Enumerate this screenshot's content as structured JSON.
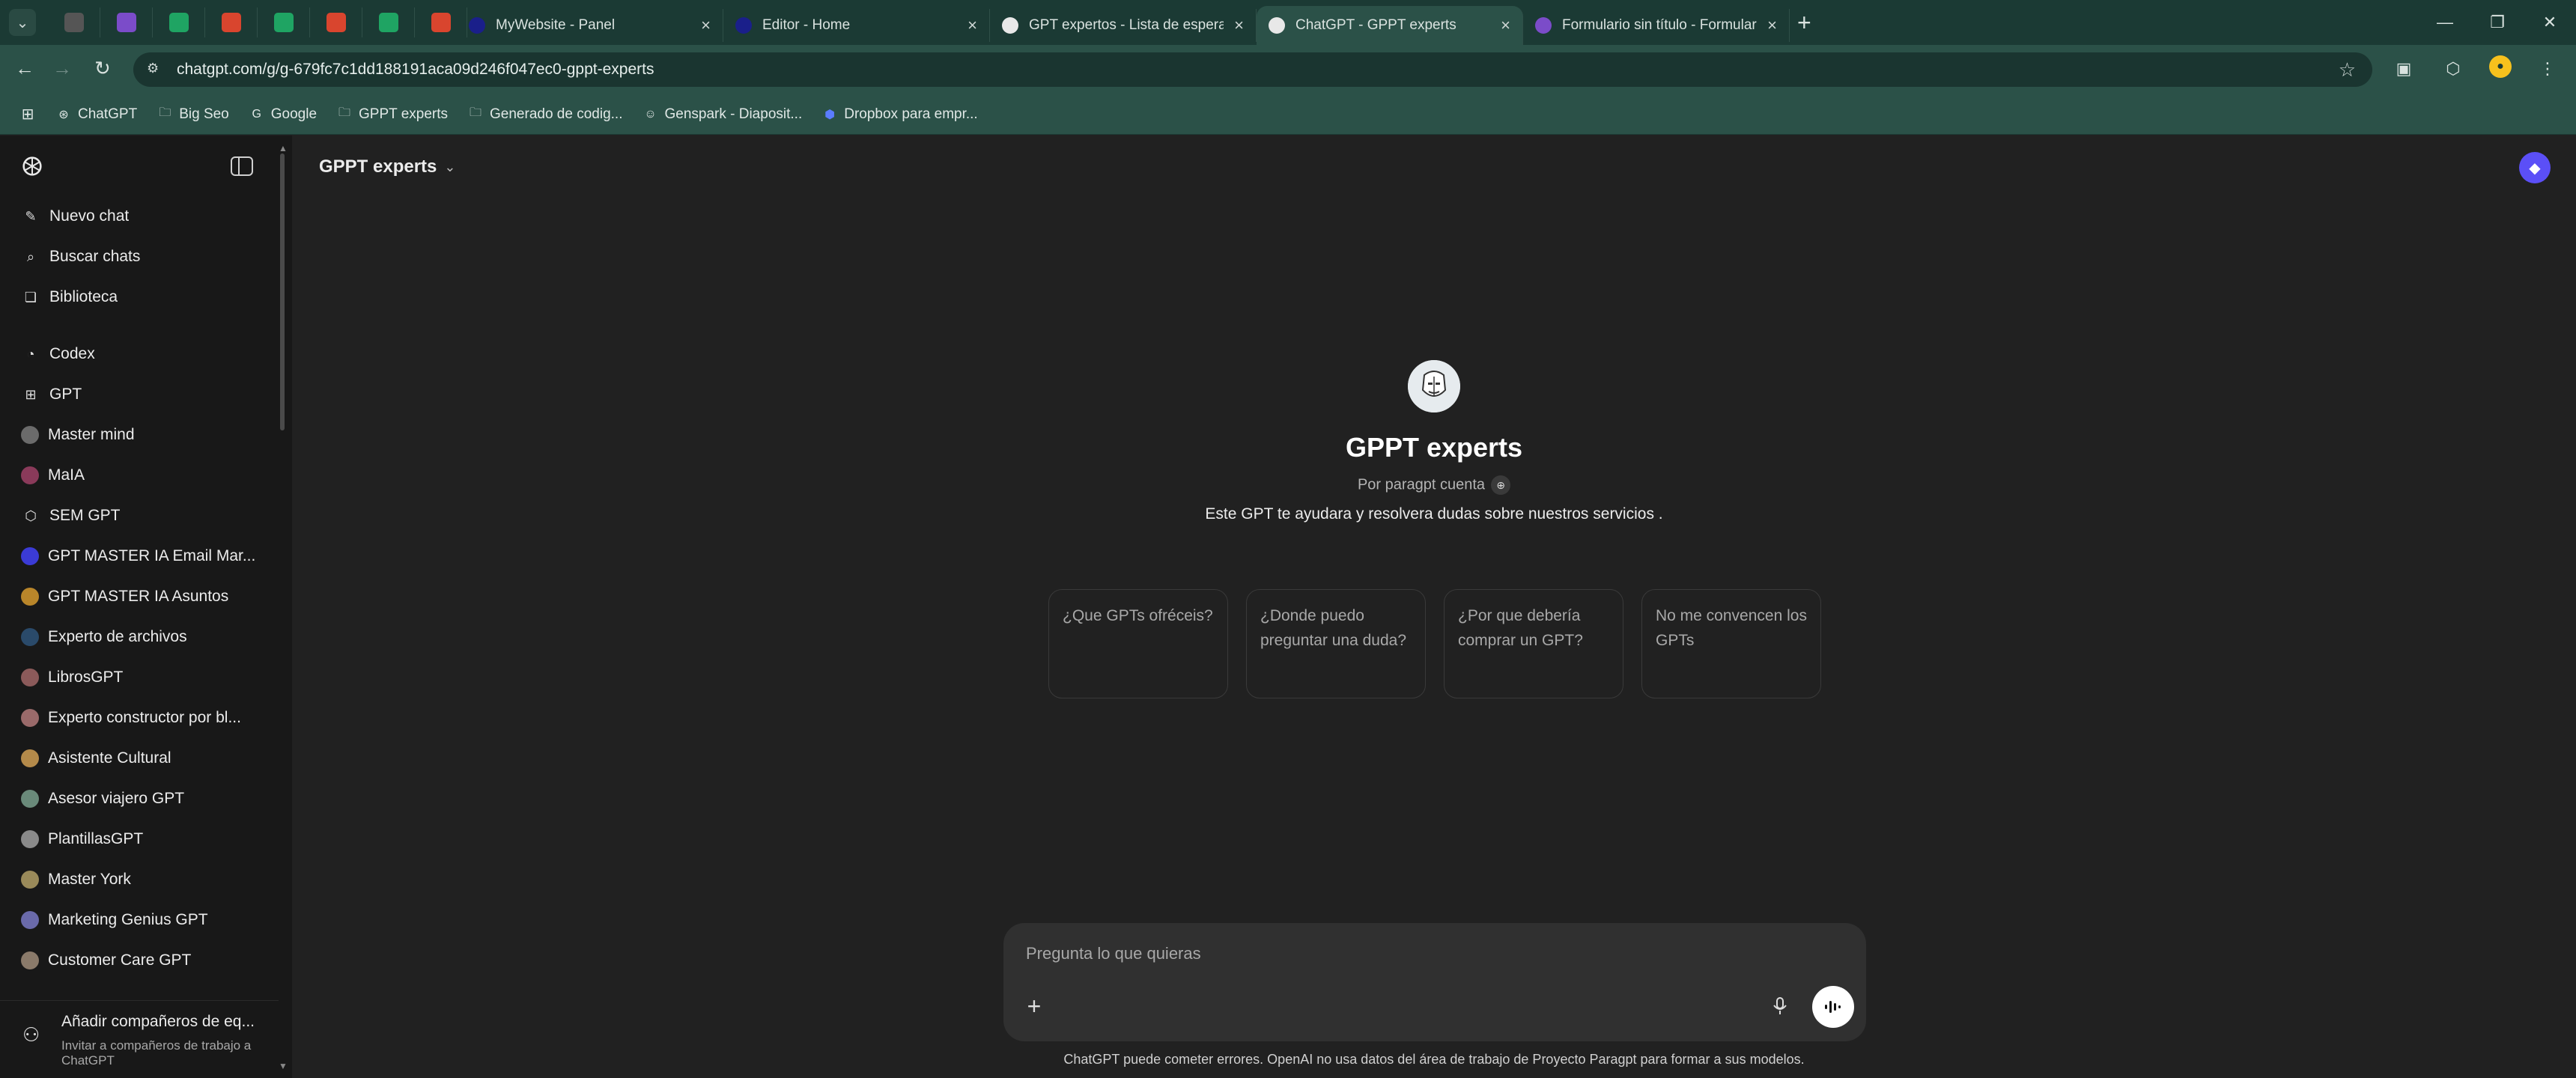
{
  "browser": {
    "tabs": [
      {
        "title": "MyWebsite - Panel",
        "favicon": "wix-icon",
        "color": "#1a1f8a"
      },
      {
        "title": "Editor - Home",
        "favicon": "wix-icon",
        "color": "#1a1f8a"
      },
      {
        "title": "GPT expertos - Lista de espera",
        "favicon": "chatgpt-icon",
        "color": "#e8e8e8"
      },
      {
        "title": "ChatGPT - GPPT experts",
        "favicon": "chatgpt-icon",
        "color": "#e8e8e8",
        "active": true
      },
      {
        "title": "Formulario sin título - Formular",
        "favicon": "forms-icon",
        "color": "#7b4cc9"
      }
    ],
    "pinned_tabs": [
      {
        "icon": "chatgpt-dark-icon",
        "color": "#555555"
      },
      {
        "icon": "forms-icon",
        "color": "#7b4cc9"
      },
      {
        "icon": "sheets-icon",
        "color": "#1fa463"
      },
      {
        "icon": "make-icon",
        "color": "#d9452e"
      },
      {
        "icon": "sheets-icon",
        "color": "#1fa463"
      },
      {
        "icon": "make-icon",
        "color": "#d9452e"
      },
      {
        "icon": "sheets-icon",
        "color": "#1fa463"
      },
      {
        "icon": "make-icon",
        "color": "#d9452e"
      }
    ],
    "url": "chatgpt.com/g/g-679fc7c1dd188191aca09d246f047ec0-gppt-experts",
    "bookmarks": [
      {
        "label": "ChatGPT",
        "icon": "chatgpt-icon"
      },
      {
        "label": "Big Seo",
        "icon": "folder-icon"
      },
      {
        "label": "Google",
        "icon": "google-icon"
      },
      {
        "label": "GPPT experts",
        "icon": "folder-icon"
      },
      {
        "label": "Generado de codig...",
        "icon": "folder-icon"
      },
      {
        "label": "Genspark - Diaposit...",
        "icon": "genspark-icon"
      },
      {
        "label": "Dropbox para empr...",
        "icon": "dropbox-icon"
      }
    ]
  },
  "sidebar": {
    "top_items": [
      {
        "label": "Nuevo chat",
        "icon": "edit-icon"
      },
      {
        "label": "Buscar chats",
        "icon": "search-icon"
      },
      {
        "label": "Biblioteca",
        "icon": "library-icon"
      }
    ],
    "items": [
      {
        "label": "Codex",
        "icon": "codex-icon"
      },
      {
        "label": "GPT",
        "icon": "grid-icon"
      },
      {
        "label": "Master mind",
        "icon": "gpt-avatar-icon",
        "color": "#6b6b6b"
      },
      {
        "label": "MaIA",
        "icon": "gpt-avatar-icon",
        "color": "#8a3a5a"
      },
      {
        "label": "SEM GPT",
        "icon": "cube-icon"
      },
      {
        "label": "GPT MASTER IA Email Mar...",
        "icon": "gpt-avatar-icon",
        "color": "#3b3bd6"
      },
      {
        "label": "GPT MASTER IA Asuntos",
        "icon": "gpt-avatar-icon",
        "color": "#b9862a"
      },
      {
        "label": "Experto de archivos",
        "icon": "gpt-avatar-icon",
        "color": "#2a4a6a"
      },
      {
        "label": "LibrosGPT",
        "icon": "gpt-avatar-icon",
        "color": "#8b5a5a"
      },
      {
        "label": "Experto constructor por bl...",
        "icon": "gpt-avatar-icon",
        "color": "#9a6a6a"
      },
      {
        "label": "Asistente Cultural",
        "icon": "gpt-avatar-icon",
        "color": "#b48a4a"
      },
      {
        "label": "Asesor viajero GPT",
        "icon": "gpt-avatar-icon",
        "color": "#6a8a7a"
      },
      {
        "label": "PlantillasGPT",
        "icon": "gpt-avatar-icon",
        "color": "#8a8a8a"
      },
      {
        "label": "Master York",
        "icon": "gpt-avatar-icon",
        "color": "#9a8a5a"
      },
      {
        "label": "Marketing Genius GPT",
        "icon": "gpt-avatar-icon",
        "color": "#6a6aaa"
      },
      {
        "label": "Customer Care GPT",
        "icon": "gpt-avatar-icon",
        "color": "#8a7a6a"
      }
    ],
    "footer": {
      "title": "Añadir compañeros de eq...",
      "subtitle": "Invitar a compañeros de trabajo a ChatGPT"
    }
  },
  "main": {
    "gpt_selector": "GPPT experts",
    "title": "GPPT experts",
    "author": "Por paragpt cuenta",
    "description": "Este GPT te ayudara y resolvera dudas sobre nuestros servicios .",
    "starters": [
      "¿Que GPTs ofréceis?",
      "¿Donde puedo preguntar una duda?",
      "¿Por que debería comprar un GPT?",
      "No me convencen los GPTs"
    ],
    "composer_placeholder": "Pregunta lo que quieras",
    "disclaimer": "ChatGPT puede cometer errores. OpenAI no usa datos del área de trabajo de Proyecto Paragpt para formar a sus modelos.",
    "accent": "#5b4ff7"
  }
}
